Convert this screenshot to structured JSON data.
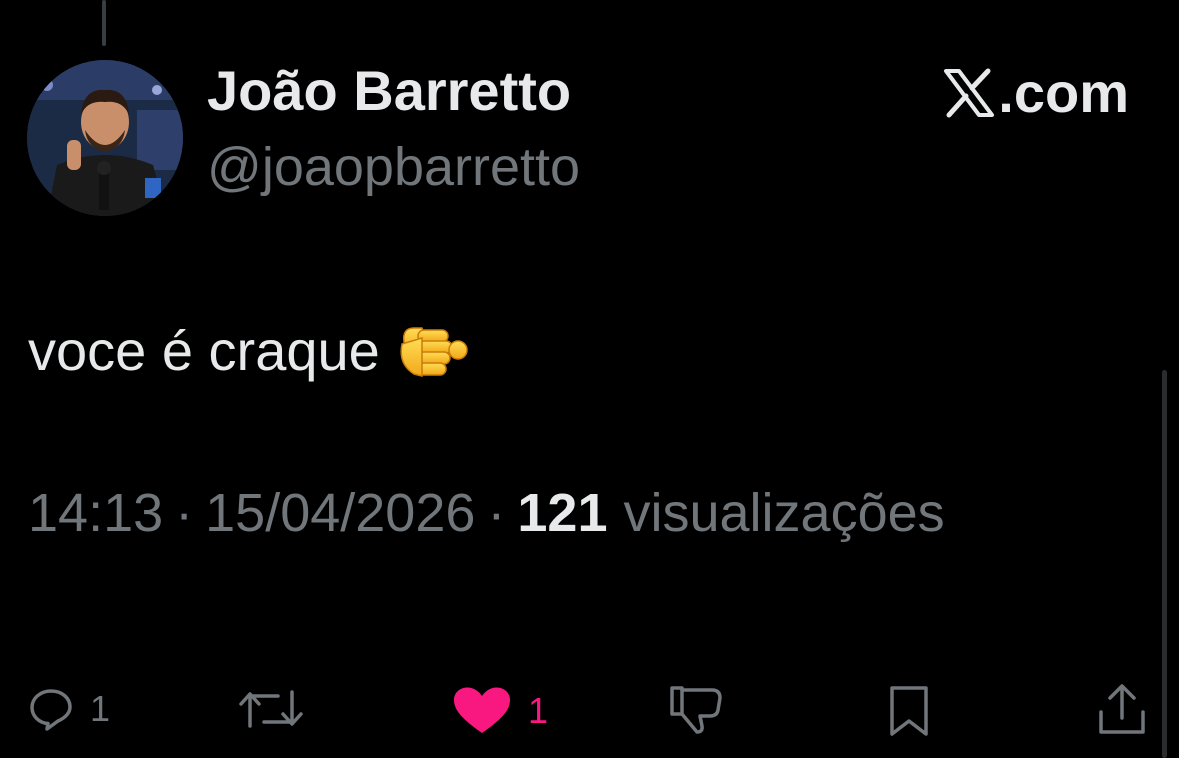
{
  "user": {
    "display_name": "João Barretto",
    "handle": "@joaopbarretto"
  },
  "brand": {
    "label": ".com",
    "icon": "x-logo-icon"
  },
  "tweet": {
    "text": "voce é craque",
    "emoji": "pointing-fist-emoji"
  },
  "meta": {
    "time": "14:13",
    "separator": "·",
    "date": "15/04/2026",
    "views_count": "121",
    "views_label": "visualizações"
  },
  "actions": {
    "reply_count": "1",
    "like_count": "1",
    "like_color": "#f91880"
  },
  "colors": {
    "background": "#000000",
    "text_primary": "#e7e9ea",
    "text_secondary": "#71767b",
    "like": "#f91880"
  }
}
